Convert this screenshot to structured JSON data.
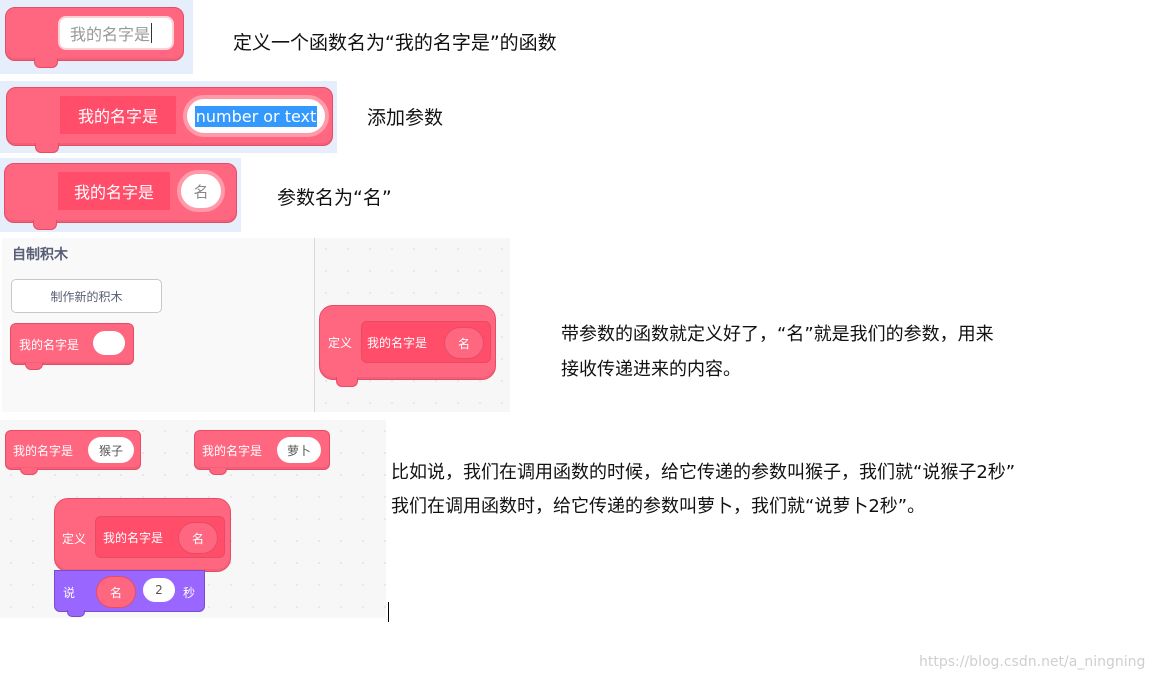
{
  "rows": {
    "row1": {
      "block_text": "我的名字是",
      "note": "定义一个函数名为“我的名字是”的函数"
    },
    "row2": {
      "label": "我的名字是",
      "input_value": "number or text",
      "note": "添加参数"
    },
    "row3": {
      "label": "我的名字是",
      "param": "名",
      "note": "参数名为“名”"
    }
  },
  "editor": {
    "palette_title": "自制积木",
    "make_block_button": "制作新的积木",
    "palette_block": "我的名字是",
    "define_label": "定义",
    "define_block": "我的名字是",
    "define_param": "名"
  },
  "notes": {
    "note4_line1": "带参数的函数就定义好了，“名”就是我们的参数，用来",
    "note4_line2": "接收传递进来的内容。",
    "note5_line1": "比如说，我们在调用函数的时候，给它传递的参数叫猴子，我们就“说猴子2秒”",
    "note5_line2": "我们在调用函数时，给它传递的参数叫萝卜，我们就“说萝卜2秒”。"
  },
  "examples": {
    "call1_label": "我的名字是",
    "call1_value": "猴子",
    "call2_label": "我的名字是",
    "call2_value": "萝卜",
    "define_label": "定义",
    "define_block": "我的名字是",
    "define_param": "名",
    "say_label": "说",
    "say_param": "名",
    "say_secs": "2",
    "say_unit": "秒"
  },
  "watermark": "https://blog.csdn.net/a_ningning",
  "colors": {
    "block_pink": "#ff6680",
    "block_pink_dark": "#ff4d6a",
    "looks_purple": "#9966ff",
    "selection_blue": "#3399ff"
  }
}
